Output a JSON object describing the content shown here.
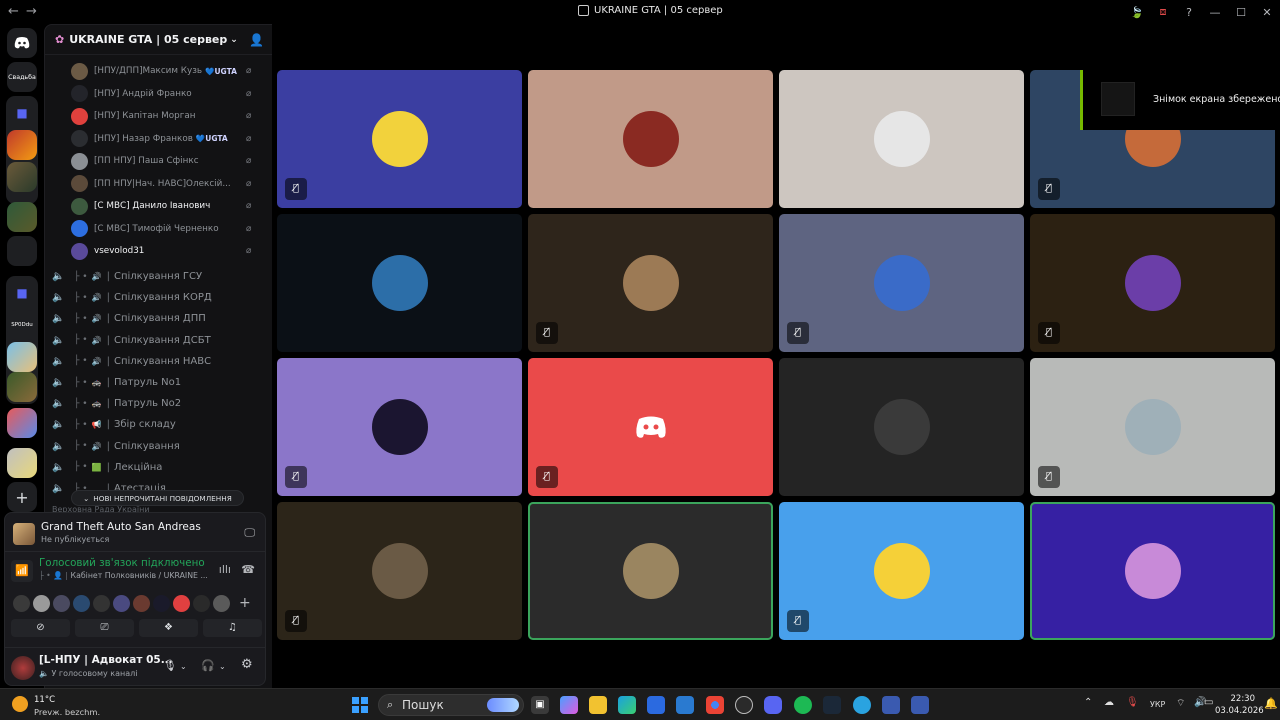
{
  "titlebar": {
    "back": "←",
    "forward": "→",
    "title": "UKRAINE GTA | 05 сервер",
    "controls": [
      "🍃",
      "⧈",
      "?",
      "—",
      "☐",
      "✕"
    ]
  },
  "rail": {
    "home_icon": "discord-icon",
    "labels": [
      "Свадьба",
      "SP0Ddu"
    ]
  },
  "server": {
    "name": "UKRAINE GTA | 05 сервер",
    "members": [
      {
        "name": "[НПУ/ДПП]Максим Кузь",
        "tag": "💙UGTA",
        "color": "#6b5a45"
      },
      {
        "name": "[НПУ] Андрій Франко",
        "tag": "",
        "color": "#23242a"
      },
      {
        "name": "[НПУ] Капітан Морган",
        "tag": "",
        "color": "#e0413d"
      },
      {
        "name": "[НПУ] Назар Франков",
        "tag": "💙UGTA",
        "color": "#2b2d31"
      },
      {
        "name": "[ПП НПУ] Паша Сфінкс",
        "tag": "",
        "color": "#8b8f94"
      },
      {
        "name": "[ПП НПУ|Нач. НАВС]Олексій...",
        "tag": "",
        "color": "#5b4a3a"
      },
      {
        "name": "[С МВС] Данило Іванович",
        "tag": "",
        "color": "#3d5a3f"
      },
      {
        "name": "[С МВС] Тимофій Черненко",
        "tag": "",
        "color": "#2d6ee0"
      },
      {
        "name": "vsevolod31",
        "tag": "",
        "color": "#5a4a9a"
      }
    ],
    "channels": [
      {
        "icon": "🔊",
        "name": "Спілкування ГСУ"
      },
      {
        "icon": "🔊",
        "name": "Спілкування КОРД"
      },
      {
        "icon": "🔊",
        "name": "Спілкування ДПП"
      },
      {
        "icon": "🔊",
        "name": "Спілкування ДСБТ"
      },
      {
        "icon": "🔊",
        "name": "Спілкування НАВС"
      },
      {
        "icon": "🚓",
        "name": "Патруль No1"
      },
      {
        "icon": "🚓",
        "name": "Патруль No2"
      },
      {
        "icon": "📢",
        "name": "Збір складу"
      },
      {
        "icon": "🔊",
        "name": "Спілкування"
      },
      {
        "icon": "🟩",
        "name": "Лекційна"
      },
      {
        "icon": "",
        "name": "Атестація"
      }
    ],
    "new_messages": "НОВІ НЕПРОЧИТАНІ ПОВІДОМЛЕННЯ",
    "faded_category": "Верховна Рада України"
  },
  "activity": {
    "game": "Grand Theft Auto San Andreas",
    "status": "Не публікується"
  },
  "voice": {
    "title": "Голосовий зв'язок підключено",
    "channel": "Кабінет Полковників / UKRAINE ..."
  },
  "user": {
    "name": "[L-НПУ | Адвокат 05...",
    "status": "У голосовому каналі"
  },
  "tiles": [
    {
      "bg": "#3b3ea1",
      "avatar": "#f2d23c",
      "muted": true
    },
    {
      "bg": "#c19a88",
      "avatar": "#8a2a22",
      "muted": false
    },
    {
      "bg": "#cdc6c0",
      "avatar": "#e6e6e6",
      "muted": false
    },
    {
      "bg": "#2e4563",
      "avatar": "#c56a3a",
      "muted": true
    },
    {
      "bg": "#0b1016",
      "avatar": "#2c6ea8",
      "muted": false
    },
    {
      "bg": "#2e251b",
      "avatar": "#9c7a55",
      "muted": true
    },
    {
      "bg": "#5e6481",
      "avatar": "#3a6bc8",
      "muted": true
    },
    {
      "bg": "#2c2112",
      "avatar": "#6b3ea8",
      "muted": true
    },
    {
      "bg": "#8b76c9",
      "avatar": "#1b1530",
      "muted": true
    },
    {
      "bg": "#ea4a4a",
      "avatar": "#ea4a4a",
      "muted": true
    },
    {
      "bg": "#242424",
      "avatar": "#3a3a3a",
      "muted": false
    },
    {
      "bg": "#b8bab8",
      "avatar": "#9fb0b8",
      "muted": true
    },
    {
      "bg": "#2c2519",
      "avatar": "#6a5a45",
      "muted": true
    },
    {
      "bg": "#2b2b2b",
      "avatar": "#9a8560",
      "muted": false
    },
    {
      "bg": "#48a0ec",
      "avatar": "#f5d038",
      "muted": true
    },
    {
      "bg": "#3620a3",
      "avatar": "#c88ad8",
      "muted": false
    }
  ],
  "toast": {
    "text": "Знімок екрана збережено"
  },
  "taskbar": {
    "temp": "11°C",
    "weather": "Prevж. bezchm.",
    "search": "Пошук",
    "lang": "УКР",
    "time": "22:30",
    "date": "03.04.2026"
  }
}
